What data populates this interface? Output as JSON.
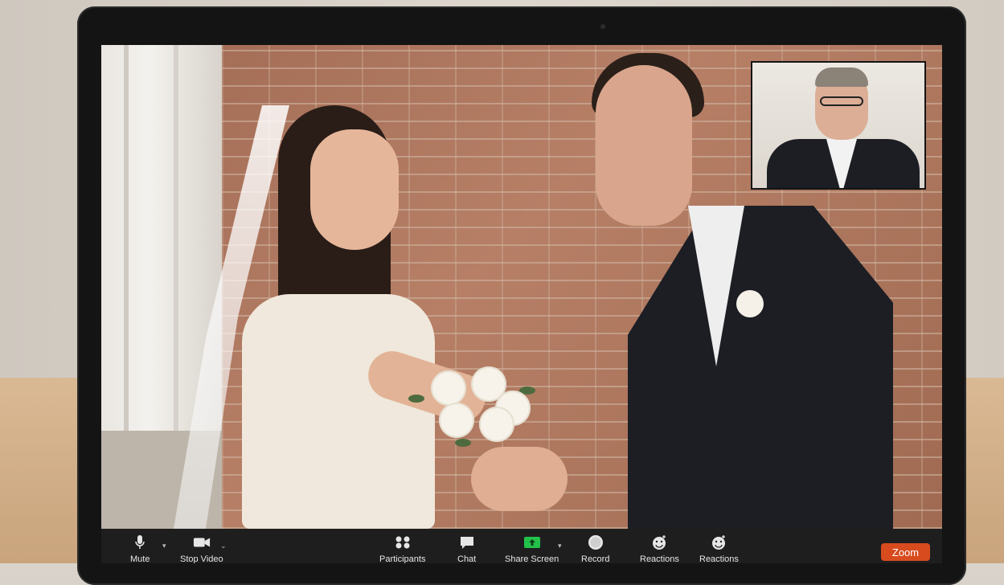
{
  "app": {
    "brand_button": "Zoom"
  },
  "toolbar": {
    "items": [
      {
        "label": "Mute",
        "icon": "microphone-icon"
      },
      {
        "label": "Stop Video",
        "icon": "video-camera-icon"
      },
      {
        "label": "Participants",
        "icon": "participants-icon"
      },
      {
        "label": "Chat",
        "icon": "chat-icon"
      },
      {
        "label": "Share Screen",
        "icon": "share-screen-icon"
      },
      {
        "label": "Record",
        "icon": "record-icon"
      },
      {
        "label": "Reactions",
        "icon": "reactions-icon"
      },
      {
        "label": "Reactions",
        "icon": "reactions-icon"
      }
    ]
  },
  "colors": {
    "share_accent": "#22c24a",
    "brand_button": "#d84b1e",
    "toolbar_bg": "#1e1e1e"
  }
}
